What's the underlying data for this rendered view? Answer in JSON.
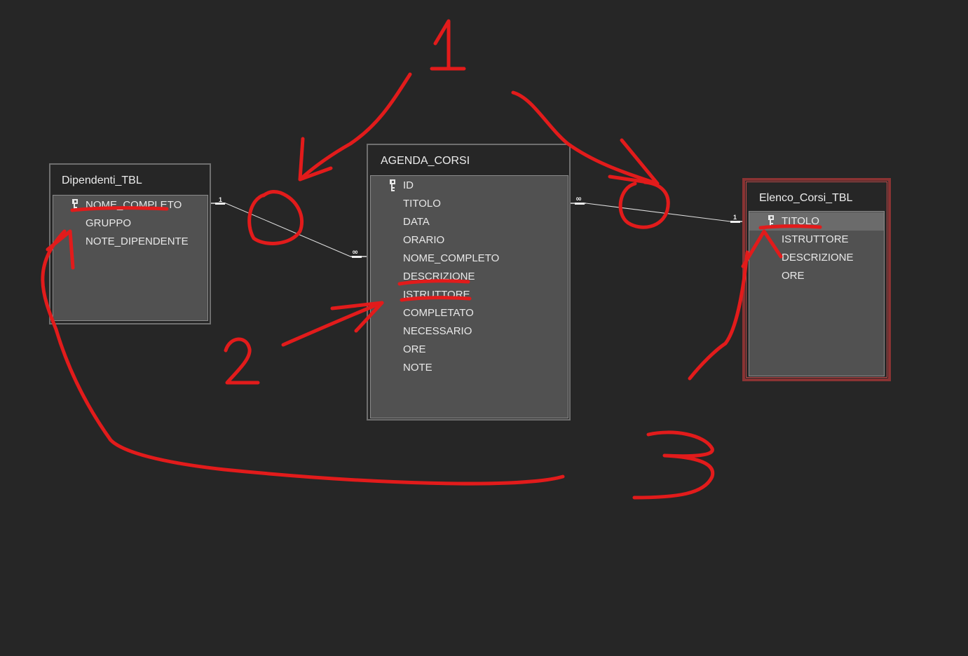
{
  "tables": {
    "dipendenti": {
      "title": "Dipendenti_TBL",
      "fields": [
        {
          "name": "NOME_COMPLETO",
          "key": true
        },
        {
          "name": "GRUPPO",
          "key": false
        },
        {
          "name": "NOTE_DIPENDENTE",
          "key": false
        }
      ]
    },
    "agenda": {
      "title": "AGENDA_CORSI",
      "fields": [
        {
          "name": "ID",
          "key": true
        },
        {
          "name": "TITOLO",
          "key": false
        },
        {
          "name": "DATA",
          "key": false
        },
        {
          "name": "ORARIO",
          "key": false
        },
        {
          "name": "NOME_COMPLETO",
          "key": false
        },
        {
          "name": "DESCRIZIONE",
          "key": false
        },
        {
          "name": "ISTRUTTORE",
          "key": false
        },
        {
          "name": "COMPLETATO",
          "key": false
        },
        {
          "name": "NECESSARIO",
          "key": false
        },
        {
          "name": "ORE",
          "key": false
        },
        {
          "name": "NOTE",
          "key": false
        }
      ]
    },
    "elenco": {
      "title": "Elenco_Corsi_TBL",
      "selected": true,
      "highlighted_field": "TITOLO",
      "fields": [
        {
          "name": "TITOLO",
          "key": true
        },
        {
          "name": "ISTRUTTORE",
          "key": false
        },
        {
          "name": "DESCRIZIONE",
          "key": false
        },
        {
          "name": "ORE",
          "key": false
        }
      ]
    }
  },
  "relationships": [
    {
      "one_label": "1",
      "many_label": "∞"
    },
    {
      "one_label": "1",
      "many_label": "∞"
    }
  ],
  "annotations": {
    "labels": [
      "1",
      "2",
      "3"
    ],
    "color": "#e21b1b"
  },
  "icons": {
    "primary_key": "key-icon",
    "relationship_line": "relationship-line"
  },
  "colors": {
    "background": "#262626",
    "table_body": "#515151",
    "table_border": "#6f6f6f",
    "selected_border": "#8a3333",
    "highlight_row": "#6b6b6b",
    "text": "#e8e8e8",
    "annotation": "#e21b1b"
  }
}
